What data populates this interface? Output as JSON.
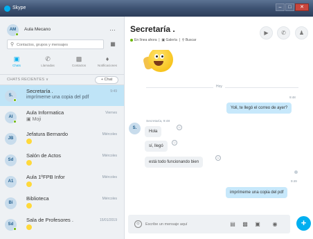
{
  "window": {
    "app_title": "Skype"
  },
  "profile": {
    "initials": "AM",
    "name": "Aula Mecano",
    "menu": "…"
  },
  "search": {
    "placeholder": "Contactos, grupos y mensajes"
  },
  "nav": {
    "chats": "Chats",
    "calls": "Llamadas",
    "contacts": "Contactos",
    "notifications": "Notificaciones"
  },
  "recent": {
    "label": "CHATS RECIENTES ∨",
    "new_chat": "+ Chat"
  },
  "chats": [
    {
      "initials": "S.",
      "name": "Secretaría .",
      "preview": "imprímeme una copia del pdf",
      "time": "9:49"
    },
    {
      "initials": "AI",
      "name": "Aula Informatica",
      "preview": "Moji",
      "time": "Viernes"
    },
    {
      "initials": "JB",
      "name": "Jefatura Bernardo",
      "preview": "",
      "time": "Miércoles"
    },
    {
      "initials": "Sd",
      "name": "Salón de Actos",
      "preview": "",
      "time": "Miércoles"
    },
    {
      "initials": "A1",
      "name": "Aula 1ºFPB Infor",
      "preview": "",
      "time": "Miércoles"
    },
    {
      "initials": "Bi",
      "name": "Biblioteca",
      "preview": "",
      "time": "Miércoles"
    },
    {
      "initials": "Sd",
      "name": "Sala de Profesores .",
      "preview": "",
      "time": "15/01/2019"
    }
  ],
  "conversation": {
    "title": "Secretaría .",
    "status": "En línea ahora",
    "gallery": "Galería",
    "search": "Buscar",
    "day_label": "Hoy",
    "sender_initials": "S.",
    "sender_line": "Secretaría, 9:48",
    "messages_out_1": {
      "time": "9:48",
      "text": "Yoli, te llegó el correo de ayer?"
    },
    "messages_in": [
      "Hola",
      "sí, llegó",
      "está todo funcionando bien"
    ],
    "messages_out_2": {
      "time": "9:49",
      "text": "imprímeme una copia del pdf"
    }
  },
  "composer": {
    "placeholder": "Escribe un mensaje aquí"
  },
  "colors": {
    "accent": "#00aff0",
    "presence": "#6bb700",
    "active_chat": "#bfe4f7",
    "out_bubble": "#c7e8fb"
  }
}
